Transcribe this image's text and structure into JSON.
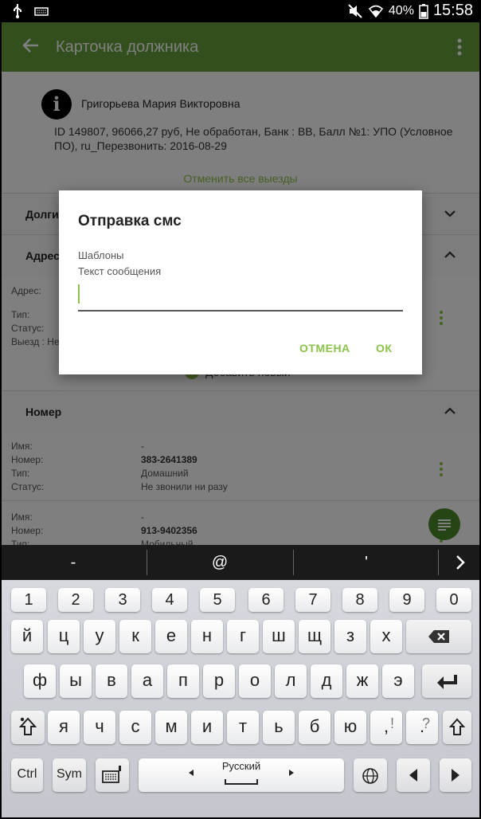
{
  "status_bar": {
    "battery": "40%",
    "time": "15:58",
    "icons": [
      "usb-icon",
      "keyboard-icon",
      "mute-icon",
      "wifi-icon",
      "battery-icon"
    ]
  },
  "app_bar": {
    "title": "Карточка должника"
  },
  "debtor": {
    "avatar_glyph": "i",
    "name": "Григорьева Мария Викторовна",
    "details": "ID 149807, 96066,27 руб, Не обработан, Банк : BB, Балл №1: УПО (Условное ПО), ru_Перезвонить: 2016-08-29"
  },
  "cancel_trips_label": "Отменить все выезды",
  "sections": {
    "debts": "Долги",
    "address": "Адрес",
    "number": "Номер"
  },
  "address_block": {
    "address_label": "Адрес:",
    "type_label": "Тип:",
    "status_label": "Статус:",
    "trip_label": "Выезд : Не"
  },
  "add_new_label": "Добавить новый",
  "phones": [
    {
      "name_label": "Имя:",
      "name_value": "-",
      "number_label": "Номер:",
      "number_value": "383-2641389",
      "type_label": "Тип:",
      "type_value": "Домашний",
      "status_label": "Статус:",
      "status_value": "Не звонили ни разу"
    },
    {
      "name_label": "Имя:",
      "name_value": "-",
      "number_label": "Номер:",
      "number_value": "913-9402356",
      "type_label": "Тип:",
      "type_value": "Мобильный"
    }
  ],
  "dialog": {
    "title": "Отправка смс",
    "templates_label": "Шаблоны",
    "message_label": "Текст сообщения",
    "message_value": "",
    "cancel_label": "ОТМЕНА",
    "ok_label": "ОК"
  },
  "keyboard": {
    "suggestions": [
      "-",
      "@",
      "'"
    ],
    "numbers": [
      "1",
      "2",
      "3",
      "4",
      "5",
      "6",
      "7",
      "8",
      "9",
      "0"
    ],
    "row1": [
      "й",
      "ц",
      "у",
      "к",
      "е",
      "н",
      "г",
      "ш",
      "щ",
      "з",
      "х"
    ],
    "row2": [
      "ф",
      "ы",
      "в",
      "а",
      "п",
      "р",
      "о",
      "л",
      "д",
      "ж",
      "э"
    ],
    "row3": [
      "я",
      "ч",
      "с",
      "м",
      "и",
      "т",
      "ь",
      "б",
      "ю"
    ],
    "row3_punct": [
      {
        "main": ",",
        "alt": "!"
      },
      {
        "main": ".",
        "alt": "?"
      }
    ],
    "ctrl_label": "Ctrl",
    "sym_label": "Sym",
    "space_label": "Русский"
  },
  "colors": {
    "app_bar": "#669e3a",
    "accent": "#8bc34a",
    "fab": "#4d8a2a"
  }
}
